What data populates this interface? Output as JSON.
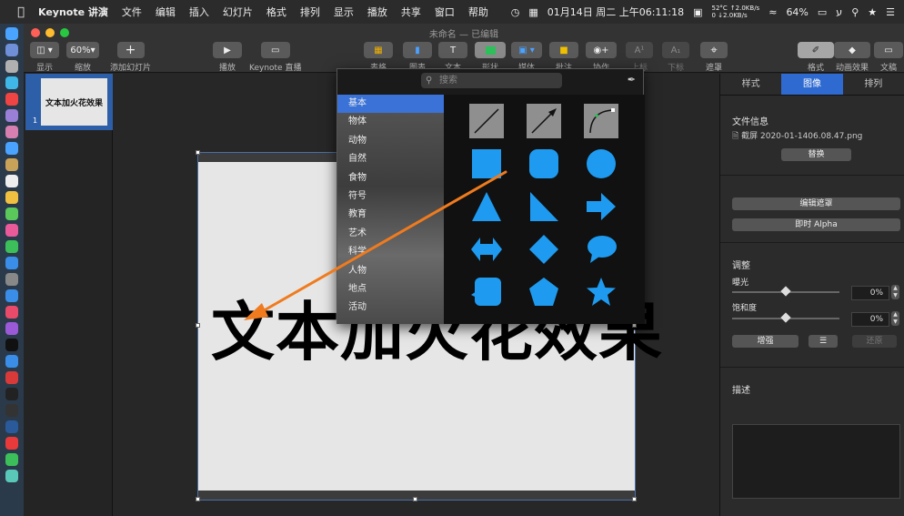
{
  "menubar": {
    "app_name": "Keynote 讲演",
    "items": [
      "文件",
      "编辑",
      "插入",
      "幻灯片",
      "格式",
      "排列",
      "显示",
      "播放",
      "共享",
      "窗口",
      "帮助"
    ],
    "temp": "52°C",
    "net_up": "↑2.0KB/s",
    "net_down": "0 ↓2.0KB/s",
    "datetime": "01月14日 周二 上午06:11:18",
    "battery": "64%"
  },
  "window": {
    "title": "未命名",
    "status": " — 已编辑",
    "toolbar": {
      "view": "显示",
      "zoom_value": "60%",
      "zoom": "缩放",
      "add_slide": "添加幻灯片",
      "play": "播放",
      "keynote_live": "Keynote 直播",
      "table": "表格",
      "chart": "图表",
      "text": "文本",
      "shape": "形状",
      "media": "媒体",
      "comment": "批注",
      "collaborate": "协作",
      "superscript": "上标",
      "subscript": "下标",
      "mask": "遮罩",
      "format": "格式",
      "animate": "动画效果",
      "document": "文稿"
    }
  },
  "navigator": {
    "thumb_text": "文本加火花效果",
    "slide_number": "1"
  },
  "slide": {
    "text": "文本加火花效果"
  },
  "shape_popup": {
    "search_placeholder": "搜索",
    "categories": [
      "基本",
      "物体",
      "动物",
      "自然",
      "食物",
      "符号",
      "教育",
      "艺术",
      "科学",
      "人物",
      "地点",
      "活动"
    ]
  },
  "inspector": {
    "tabs": [
      "样式",
      "图像",
      "排列"
    ],
    "file_info_title": "文件信息",
    "file_name": "截屏 2020-01-1406.08.47.png",
    "replace": "替换",
    "edit_mask": "编辑遮罩",
    "instant_alpha": "即时 Alpha",
    "adjust_title": "调整",
    "exposure_label": "曝光",
    "exposure_value": "0%",
    "saturation_label": "饱和度",
    "saturation_value": "0%",
    "enhance": "增强",
    "reset": "还原",
    "description_title": "描述"
  },
  "colors": {
    "accent": "#2f6ad1",
    "shape_blue": "#1e9bf0",
    "arrow_orange": "#f07b1e"
  }
}
